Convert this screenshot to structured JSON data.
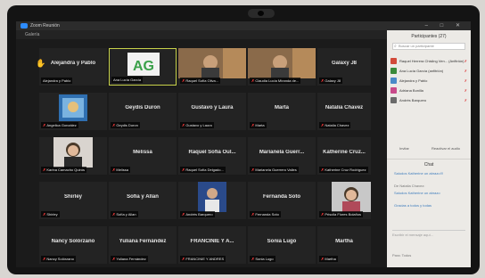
{
  "window": {
    "title": "Zoom Reunión",
    "subtitle": "Galería"
  },
  "gallery": {
    "rows": [
      [
        {
          "name": "Alejandra y Pablo",
          "label": "Alejandra y Pablo",
          "muted": false
        },
        {
          "name": "",
          "label": "Ana Lucía García",
          "muted": false,
          "active": true,
          "kind": "logo",
          "logo_text": "AG"
        },
        {
          "name": "",
          "label": "Raquel Sofía Oliva...",
          "muted": true,
          "kind": "photo"
        },
        {
          "name": "",
          "label": "Claudia Lucía Miranda de...",
          "muted": true,
          "kind": "photo"
        },
        {
          "name": "Galaxy J8",
          "label": "Galaxy J8",
          "muted": true
        }
      ],
      [
        {
          "name": "",
          "label": "Angelica González",
          "muted": true,
          "kind": "poster"
        },
        {
          "name": "Geydis Duron",
          "label": "Geydis Duron",
          "muted": true
        },
        {
          "name": "Gustavo y Laura",
          "label": "Gustavo y Laura",
          "muted": true
        },
        {
          "name": "Marta",
          "label": "Marta",
          "muted": true
        },
        {
          "name": "Natalia Chavez",
          "label": "Natalia Chavez",
          "muted": true
        }
      ],
      [
        {
          "name": "",
          "label": "Karina Camacho Quirós",
          "muted": true,
          "kind": "woman"
        },
        {
          "name": "Melissa",
          "label": "Melissa",
          "muted": true
        },
        {
          "name": "Raquel Sofía Oul...",
          "label": "Raquel Sofía Delgado...",
          "muted": true
        },
        {
          "name": "Marianela Guerr...",
          "label": "Marianela Guerrero Valles",
          "muted": true
        },
        {
          "name": "Katherine Cruz...",
          "label": "Katherine Cruz Rodríguez",
          "muted": true
        }
      ],
      [
        {
          "name": "Shirley",
          "label": "Shirley",
          "muted": true
        },
        {
          "name": "Sofía y Allan",
          "label": "Sofía y Allan",
          "muted": true
        },
        {
          "name": "",
          "label": "Andrés Barquero",
          "muted": true,
          "kind": "man"
        },
        {
          "name": "Fernanda Soto",
          "label": "Fernanda Soto",
          "muted": true
        },
        {
          "name": "",
          "label": "Priscila Flores Bolaños",
          "muted": true,
          "kind": "lady"
        }
      ],
      [
        {
          "name": "Nancy Solórzano",
          "label": "Nancy Solórzano",
          "muted": true
        },
        {
          "name": "Yuliana Fernández",
          "label": "Yuliana Fernández",
          "muted": true
        },
        {
          "name": "FRANCINIE Y A...",
          "label": "FRANCINIE Y ANDRES",
          "muted": true
        },
        {
          "name": "Sonia Lugo",
          "label": "Sonia Lugo",
          "muted": true
        },
        {
          "name": "Martha",
          "label": "Martha",
          "muted": true
        }
      ]
    ]
  },
  "panel": {
    "title": "Participantes (27)",
    "search_placeholder": "Buscar un participante",
    "participants": [
      {
        "name": "Raquel Herrera Chisling Ven...",
        "status": "(Anfitrión)",
        "color": "#d24a3a"
      },
      {
        "name": "Ana Lucía García (anfitrión)",
        "status": "",
        "color": "#3a8a3a"
      },
      {
        "name": "Alejandra y Pablo",
        "status": "",
        "color": "#4a8ac8"
      },
      {
        "name": "Adriana Bonilla",
        "status": "",
        "color": "#c84a8a"
      },
      {
        "name": "Andrés Barquero",
        "status": "",
        "color": "#6a6a6a"
      }
    ],
    "invite_label": "Invitar",
    "mute_all_label": "Reactivar el audio",
    "chat_title": "Chat",
    "chat_messages": [
      {
        "from": "",
        "text": "Saludos Katherine un abrazo!!!"
      },
      {
        "from": "De Natalia Chavez:",
        "text": "Saludos Katherine un abrazo"
      },
      {
        "from": "",
        "text": "Gracias a todos y todas"
      }
    ],
    "chat_input_placeholder": "Escribir el mensaje aquí...",
    "chat_footer": "Para: Todos"
  }
}
